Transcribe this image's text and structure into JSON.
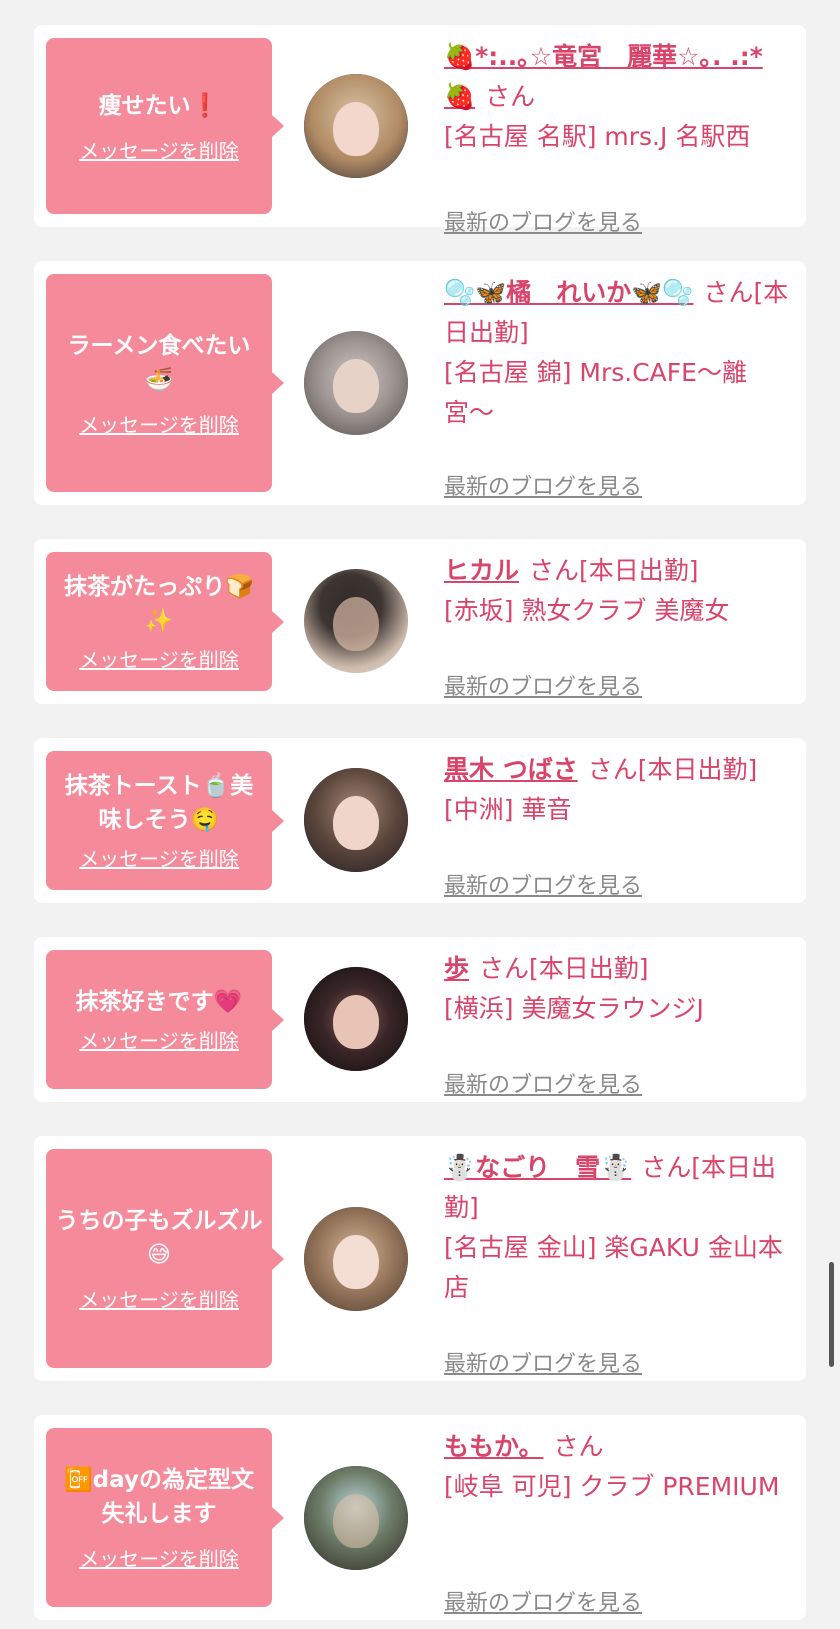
{
  "accent_color": "#f58a9b",
  "link_color": "#d9446a",
  "messages": [
    {
      "message": "痩せたい❗️",
      "delete_label": "メッセージを削除",
      "name": "🍓*:..｡☆竜宮　麗華☆｡. .:*🍓",
      "suffix": "さん",
      "shop": "[名古屋 名駅] mrs.J 名駅西",
      "blog_label": "最新のブログを見る"
    },
    {
      "message": "ラーメン食べたい🍜",
      "delete_label": "メッセージを削除",
      "name": "🫧🦋橘　れいか🦋🫧",
      "suffix": "さん[本日出勤]",
      "shop": "[名古屋 錦] Mrs.CAFE〜離宮〜",
      "blog_label": "最新のブログを見る"
    },
    {
      "message": "抹茶がたっぷり🍞✨",
      "delete_label": "メッセージを削除",
      "name": "ヒカル",
      "suffix": "さん[本日出勤]",
      "shop": "[赤坂] 熟女クラブ 美魔女",
      "blog_label": "最新のブログを見る"
    },
    {
      "message": "抹茶トースト🍵美味しそう🤤",
      "delete_label": "メッセージを削除",
      "name": "黒木 つばさ",
      "suffix": "さん[本日出勤]",
      "shop": "[中洲] 華音",
      "blog_label": "最新のブログを見る"
    },
    {
      "message": "抹茶好きです💗",
      "delete_label": "メッセージを削除",
      "name": "歩",
      "suffix": "さん[本日出勤]",
      "shop": "[横浜] 美魔女ラウンジJ",
      "blog_label": "最新のブログを見る"
    },
    {
      "message": "うちの子もズルズル😅",
      "delete_label": "メッセージを削除",
      "name": "☃️なごり　雪☃️",
      "suffix": "さん[本日出勤]",
      "shop": "[名古屋 金山] 楽GAKU 金山本店",
      "blog_label": "最新のブログを見る"
    },
    {
      "message": "📴dayの為定型文失礼します",
      "delete_label": "メッセージを削除",
      "name": "ももか。",
      "suffix": "さん",
      "shop": "[岐阜 可児] クラブ PREMIUM",
      "blog_label": "最新のブログを見る"
    }
  ]
}
